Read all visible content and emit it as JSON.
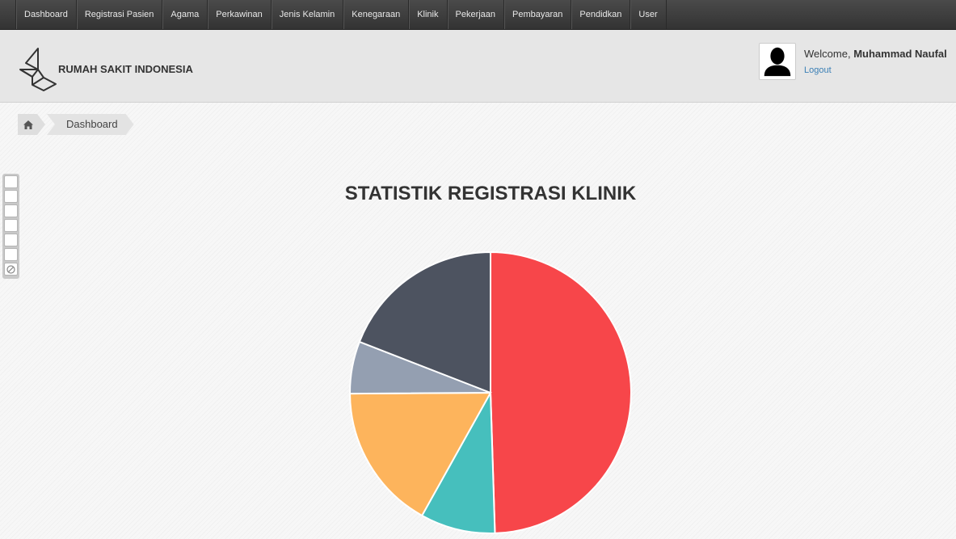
{
  "nav": {
    "items": [
      "Dashboard",
      "Registrasi Pasien",
      "Agama",
      "Perkawinan",
      "Jenis Kelamin",
      "Kenegaraan",
      "Klinik",
      "Pekerjaan",
      "Pembayaran",
      "Pendidkan",
      "User"
    ]
  },
  "header": {
    "brand": "RUMAH SAKIT INDONESIA",
    "welcome_prefix": "Welcome,",
    "user_name": "Muhammad Naufal",
    "logout_label": "Logout"
  },
  "breadcrumb": {
    "home_icon": "home-icon",
    "current": "Dashboard"
  },
  "side_toolbar": {
    "buttons": 7,
    "last_icon": "disabled-icon"
  },
  "chart_data": {
    "type": "pie",
    "title": "STATISTIK REGISTRASI KLINIK",
    "values": [
      49.5,
      8.6,
      16.8,
      6.0,
      19.1
    ],
    "colors": [
      "#f7464a",
      "#46bfbd",
      "#fdb45c",
      "#949fb1",
      "#4d5360"
    ]
  }
}
